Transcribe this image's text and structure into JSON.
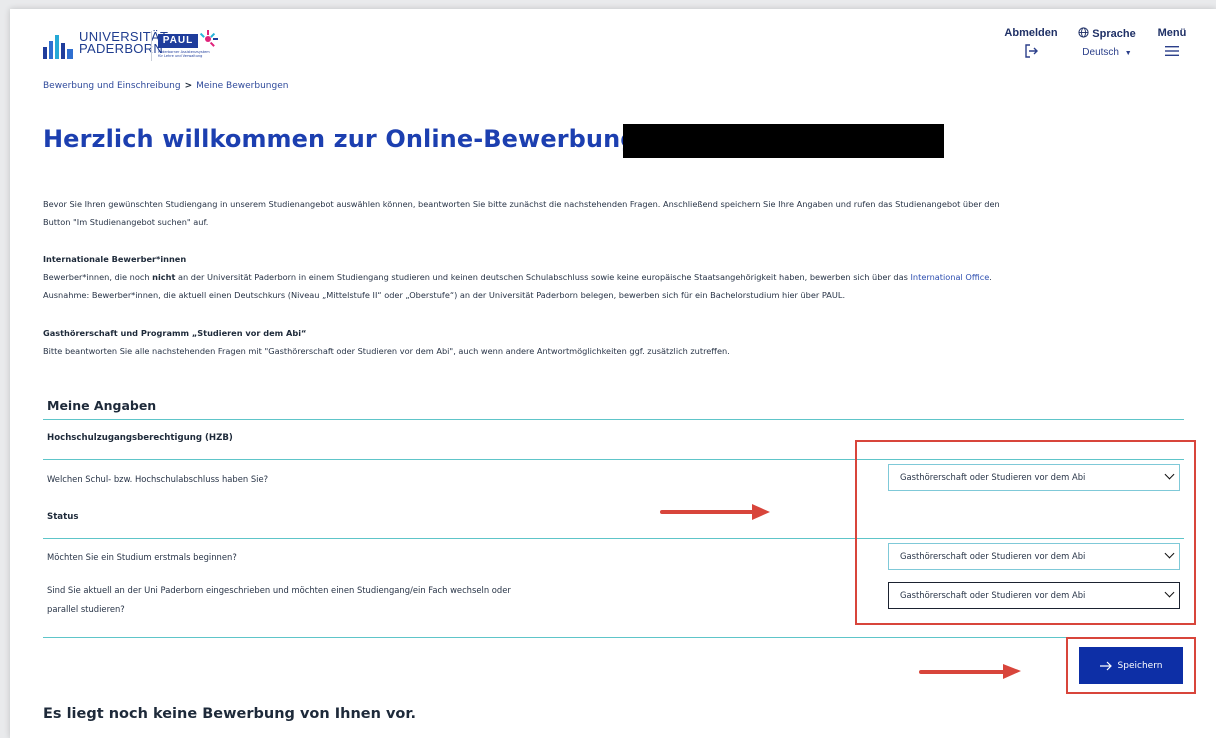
{
  "header": {
    "logo_text_line1": "UNIVERSITÄT",
    "logo_text_line2": "PADERBORN",
    "paul_badge": "PAUL",
    "paul_subtitle": "Paderborner Assistenzsystem für Lehre und Verwaltung",
    "nav": {
      "logout_label": "Abmelden",
      "language_label": "Sprache",
      "language_value": "Deutsch",
      "menu_label": "Menü"
    },
    "icons": {
      "logout": "logout-icon",
      "language": "globe-icon",
      "menu": "hamburger-icon",
      "language_dropdown": "chevron-down-icon"
    }
  },
  "breadcrumb": {
    "items": [
      "Bewerbung und Einschreibung",
      "Meine Bewerbungen"
    ],
    "separator": ">"
  },
  "main": {
    "title": "Herzlich willkommen zur Online-Bewerbung,",
    "intro_line1": "Bevor Sie Ihren gewünschten Studiengang in unserem Studienangebot auswählen können, beantworten Sie bitte zunächst die nachstehenden Fragen. Anschließend speichern Sie Ihre Angaben und rufen das Studienangebot über den",
    "intro_line2": "Button \"Im Studienangebot suchen\" auf.",
    "international": {
      "heading": "Internationale Bewerber*innen",
      "line1_pre": "Bewerber*innen, die noch ",
      "line1_bold": "nicht",
      "line1_post": " an der Universität Paderborn in einem Studiengang studieren und keinen deutschen Schulabschluss sowie keine europäische Staatsangehörigkeit haben, bewerben sich über das ",
      "line1_link": "International Office",
      "line1_end": ".",
      "line2": "Ausnahme: Bewerber*innen, die aktuell einen Deutschkurs (Niveau „Mittelstufe II“ oder „Oberstufe“) an der Universität Paderborn belegen, bewerben sich für ein Bachelorstudium hier über PAUL."
    },
    "guest": {
      "heading": "Gasthörerschaft und Programm „Studieren vor dem Abi“",
      "line1": "Bitte beantworten Sie alle nachstehenden Fragen mit \"Gasthörerschaft oder Studieren vor dem Abi\", auch wenn andere Antwortmöglichkeiten ggf. zusätzlich zutreffen."
    },
    "form": {
      "heading": "Meine Angaben",
      "section_hzb": "Hochschulzugangsberechtigung (HZB)",
      "q1": "Welchen Schul- bzw. Hochschulabschluss haben Sie?",
      "q1_value": "Gasthörerschaft oder Studieren vor dem Abi",
      "section_status": "Status",
      "q2": "Möchten Sie ein Studium erstmals beginnen?",
      "q2_value": "Gasthörerschaft oder Studieren vor dem Abi",
      "q3_line1": "Sind Sie aktuell an der Uni Paderborn eingeschrieben und möchten einen Studiengang/ein Fach wechseln oder",
      "q3_line2": "parallel studieren?",
      "q3_value": "Gasthörerschaft oder Studieren vor dem Abi",
      "save_label": "Speichern"
    },
    "no_application": "Es liegt noch keine Bewerbung von Ihnen vor."
  },
  "colors": {
    "title_blue": "#1c3fb0",
    "button_blue": "#0d2fa6",
    "rule_teal": "#5ec5c9",
    "annotation_red": "#d8453b",
    "link_blue": "#2e4fb0"
  }
}
